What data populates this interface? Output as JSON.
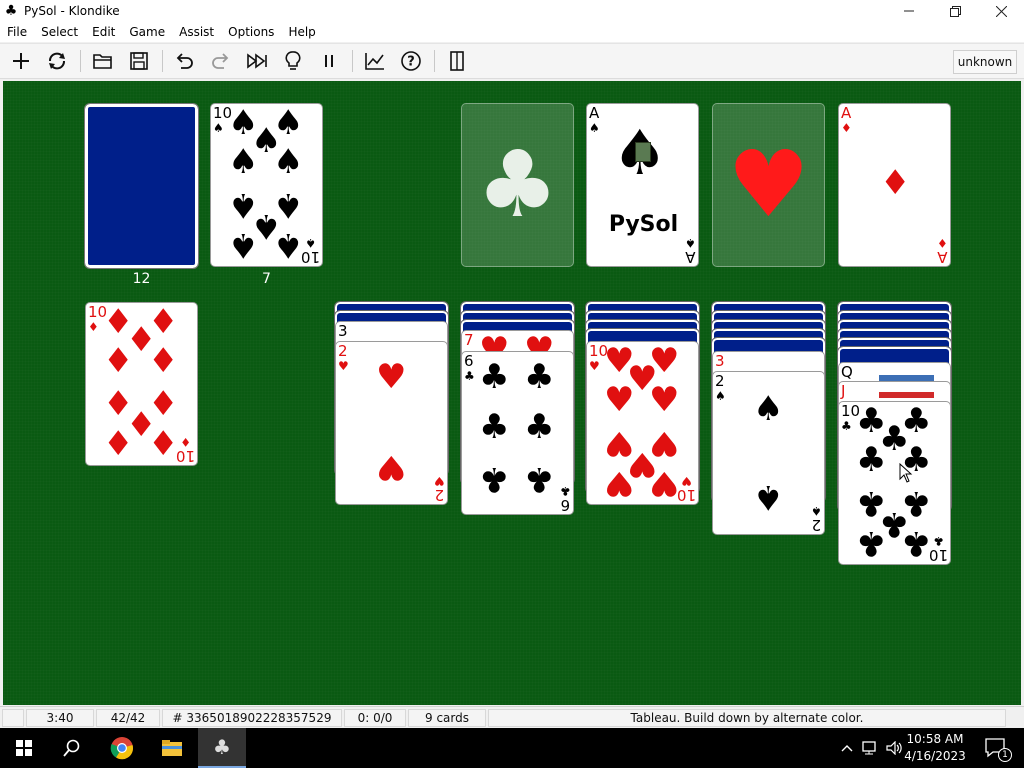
{
  "window": {
    "title": "PySol - Klondike",
    "app_icon": "club-suit-icon",
    "controls": [
      "minimize",
      "maximize",
      "close"
    ]
  },
  "menu": [
    "File",
    "Select",
    "Edit",
    "Game",
    "Assist",
    "Options",
    "Help"
  ],
  "toolbar": {
    "buttons": [
      "new-game",
      "restart",
      "open",
      "save",
      "undo",
      "redo",
      "autodrop",
      "hint",
      "pause",
      "statistics",
      "rules",
      "quit"
    ],
    "player": "unknown"
  },
  "game": {
    "stock": {
      "count": "12"
    },
    "waste": {
      "count": "7",
      "top": {
        "rank": "10",
        "suit": "♠"
      }
    },
    "foundations": [
      {
        "empty_suit": "♣"
      },
      {
        "rank": "A",
        "suit": "♠",
        "logo": "PySol"
      },
      {
        "empty_suit": "♥"
      },
      {
        "rank": "A",
        "suit": "♦"
      }
    ],
    "reserve_card": {
      "rank": "10",
      "suit": "♦"
    },
    "tableau": [
      {
        "hidden": 2,
        "visible": [
          {
            "rank": "3",
            "suit": "♠"
          },
          {
            "rank": "2",
            "suit": "♥"
          }
        ]
      },
      {
        "hidden": 3,
        "visible": [
          {
            "rank": "7",
            "suit": "♥"
          },
          {
            "rank": "6",
            "suit": "♣"
          }
        ]
      },
      {
        "hidden": 4,
        "visible": [
          {
            "rank": "10",
            "suit": "♥"
          }
        ]
      },
      {
        "hidden": 5,
        "visible": [
          {
            "rank": "3",
            "suit": "♥"
          },
          {
            "rank": "2",
            "suit": "♠"
          }
        ]
      },
      {
        "hidden": 6,
        "visible": [
          {
            "rank": "Q",
            "suit": "♥"
          },
          {
            "rank": "J",
            "suit": "♦"
          },
          {
            "rank": "10",
            "suit": "♣"
          }
        ]
      }
    ]
  },
  "status": {
    "time": "3:40",
    "moves": "42/42",
    "game_number": "# 3365018902228357529",
    "score": "0: 0/0",
    "cards": "9 cards",
    "hint": "Tableau. Build down by alternate color."
  },
  "taskbar": {
    "time": "10:58 AM",
    "date": "4/16/2023",
    "notifications": "1"
  }
}
